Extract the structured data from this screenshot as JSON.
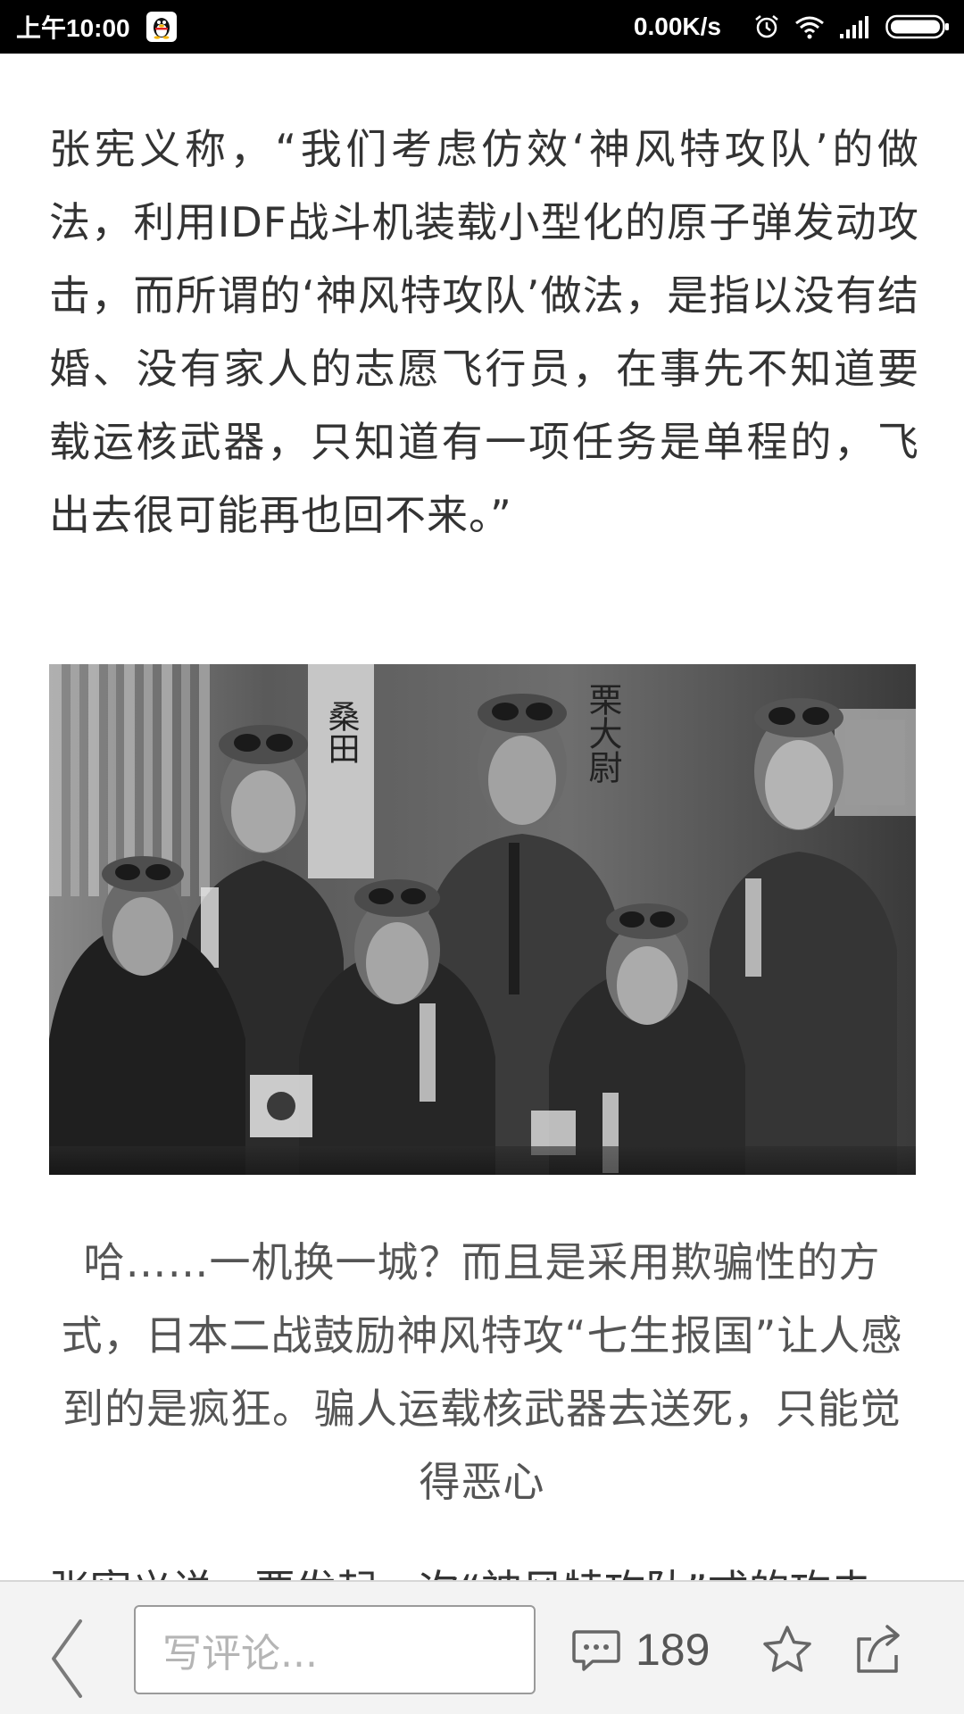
{
  "status_bar": {
    "time": "上午10:00",
    "net_speed": "0.00K/s"
  },
  "article": {
    "paragraph": "张宪义称，“我们考虑仿效‘神风特攻队’的做法，利用IDF战斗机装载小型化的原子弹发动攻击，而所谓的‘神风特攻队’做法，是指以没有结婚、没有家人的志愿飞行员，在事先不知道要载运核武器，只知道有一项任务是单程的，飞出去很可能再也回不来。”",
    "photo_inscriptions": [
      "桑田",
      "栗大尉"
    ],
    "caption": "哈……一机换一城？而且是采用欺骗性的方式，日本二战鼓励神风特攻“七生报国”让人感到的是疯狂。骗人运载核武器去送死，只能觉得恶心",
    "next_paragraph": "张宪义说，要发起一次“神风特攻队”式的攻击"
  },
  "bottom_bar": {
    "comment_placeholder": "写评论...",
    "comment_count": "189",
    "icons": [
      "back-chevron-icon",
      "comment-bubble-icon",
      "star-icon",
      "share-icon"
    ]
  },
  "colors": {
    "status_bar_bg": "#000000",
    "body_text": "#333333",
    "caption_text": "#555555",
    "bottom_bar_bg": "#f3f3f3"
  }
}
